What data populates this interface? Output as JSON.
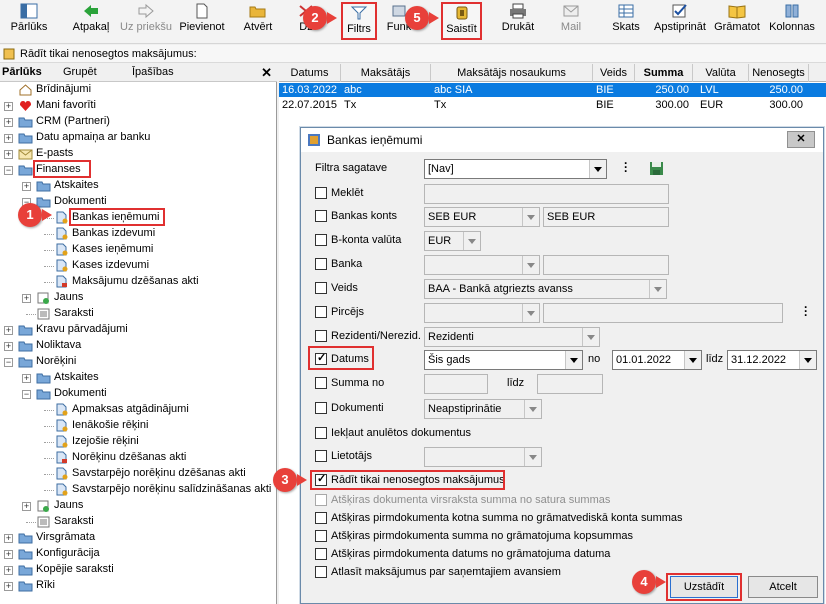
{
  "toolbar": {
    "buttons": [
      {
        "label": "Pārlūks",
        "icon": "browser-icon"
      },
      {
        "label": "Atpakaļ",
        "icon": "back-arrow-icon"
      },
      {
        "label": "Uz priekšu",
        "icon": "forward-arrow-icon"
      },
      {
        "label": "Pievienot",
        "icon": "new-document-icon"
      },
      {
        "label": "Atvērt",
        "icon": "open-folder-icon"
      },
      {
        "label": "Dz",
        "icon": "delete-icon"
      },
      {
        "label": "Filtrs",
        "icon": "filter-icon"
      },
      {
        "label": "Funk",
        "icon": "functions-icon"
      },
      {
        "label": "Saistīt",
        "icon": "link-icon"
      },
      {
        "label": "Drukāt",
        "icon": "printer-icon"
      },
      {
        "label": "Mail",
        "icon": "mail-icon"
      },
      {
        "label": "Skats",
        "icon": "view-icon"
      },
      {
        "label": "Apstiprināt",
        "icon": "approve-icon"
      },
      {
        "label": "Grāmatot",
        "icon": "book-icon"
      },
      {
        "label": "Kolonnas",
        "icon": "columns-icon"
      }
    ]
  },
  "statusline": {
    "text": "Rādīt tikai nenosegtos maksājumus:"
  },
  "leftpanel": {
    "tabs": [
      "Pārlūks",
      "Grupēt",
      "Īpašības"
    ],
    "close": "✕",
    "tree": [
      "Brīdinājumi",
      "Mani favorīti",
      "CRM (Partneri)",
      "Datu apmaiņa ar banku",
      "E-pasts",
      "Finanses",
      "Atskaites",
      "Dokumenti",
      "Bankas ieņēmumi",
      "Bankas izdevumi",
      "Kases ieņēmumi",
      "Kases izdevumi",
      "Maksājumu dzēšanas akti",
      "Jauns",
      "Saraksti",
      "Kravu pārvadājumi",
      "Noliktava",
      "Norēķini",
      "Atskaites",
      "Dokumenti",
      "Apmaksas atgādinājumi",
      "Ienākošie rēķini",
      "Izejošie rēķini",
      "Norēķinu dzēšanas akti",
      "Savstarpējo norēķinu dzēšanas akti",
      "Savstarpējo norēķinu salīdzināšanas akti",
      "Jauns",
      "Saraksti",
      "Virsgrāmata",
      "Konfigurācija",
      "Kopējie saraksti",
      "Rīki"
    ]
  },
  "grid": {
    "columns": [
      "Datums",
      "Maksātājs",
      "Maksātājs nosaukums",
      "Veids",
      "Summa",
      "Valūta",
      "Nenosegts"
    ],
    "rows": [
      [
        "16.03.2022",
        "abc",
        "abc SIA",
        "BIE",
        "250.00",
        "LVL",
        "250.00"
      ],
      [
        "22.07.2015",
        "Tx",
        "Tx",
        "BIE",
        "300.00",
        "EUR",
        "300.00"
      ]
    ]
  },
  "dialog": {
    "title": "Bankas ieņēmumi",
    "close": "✕",
    "template_label": "Filtra sagatave",
    "template_value": "[Nav]",
    "fields": {
      "meklet": "Meklēt",
      "bankas_konts": "Bankas konts",
      "bankas_konts_code": "SEB EUR",
      "bankas_konts_name": "SEB EUR",
      "bkonta_valuta": "B-konta valūta",
      "bkonta_valuta_value": "EUR",
      "banka": "Banka",
      "veids": "Veids",
      "veids_value": "BAA - Bankā atgriezts avanss",
      "pircejs": "Pircējs",
      "rezidenti": "Rezidenti/Nerezid.",
      "rezidenti_value": "Rezidenti",
      "datums": "Datums",
      "datums_period": "Šis gads",
      "no": "no",
      "date_from": "01.01.2022",
      "lidz": "līdz",
      "date_to": "31.12.2022",
      "summa_no": "Summa no",
      "summa_lidz": "līdz",
      "dokumenti": "Dokumenti",
      "dokumenti_value": "Neapstiprinātie",
      "ieklaut_anuletos": "Iekļaut anulētos dokumentus",
      "lietotajs": "Lietotājs",
      "radit_nenosegtos": "Rādīt tikai nenosegtos maksājumus",
      "opt1": "Atšķiras dokumenta virsraksta summa no satura summas",
      "opt2": "Atšķiras pirmdokumenta kotna summa no grāmatvediskā konta summas",
      "opt3": "Atšķiras pirmdokumenta summa no grāmatojuma kopsummas",
      "opt4": "Atšķiras pirmdokumenta datums no grāmatojuma datuma",
      "opt5": "Atlasīt maksājumus par saņemtajiem avansiem"
    },
    "buttons": {
      "apply": "Uzstādīt",
      "cancel": "Atcelt"
    }
  },
  "badges": [
    "1",
    "2",
    "3",
    "4",
    "5"
  ],
  "colors": {
    "accent": "#0a7be0",
    "highlight": "#e03030",
    "badge": "#e8403a"
  }
}
